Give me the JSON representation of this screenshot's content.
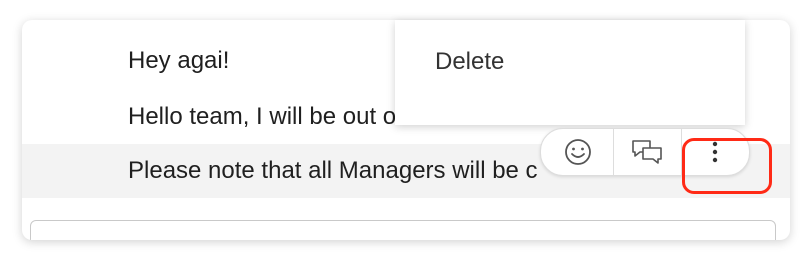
{
  "messages": [
    {
      "text": "Hey agai!"
    },
    {
      "text": "Hello team, I will be out of"
    },
    {
      "text": "Please note that all Managers will be c"
    }
  ],
  "context_menu": {
    "items": [
      {
        "label": "Delete"
      }
    ]
  },
  "message_actions": {
    "icons": [
      "smiley-icon",
      "reply-bubbles-icon",
      "more-vertical-icon"
    ]
  },
  "colors": {
    "highlight": "#ff2a16",
    "hover_row": "#f3f3f3"
  }
}
